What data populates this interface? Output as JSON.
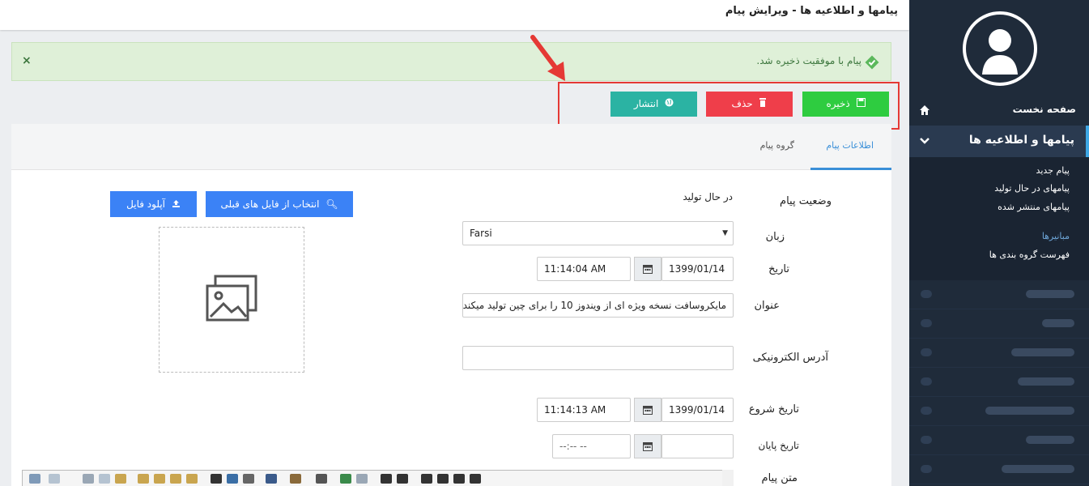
{
  "header": {
    "title": "پیامها و اطلاعیه ها - ویرایش پیام"
  },
  "alert": {
    "message": "پیام با موفقیت ذخیره شد.",
    "close": "×"
  },
  "actions": {
    "save": "ذخیره",
    "delete": "حذف",
    "publish": "انتشار"
  },
  "sidebar": {
    "home": "صفحه نخست",
    "active_menu": "پیامها و اطلاعیه ها",
    "sub_items": [
      "پیام جدید",
      "پیامهای در حال تولید",
      "پیامهای منتشر شده"
    ],
    "section": "مبانیرها",
    "section_items": [
      "فهرست گروه بندی ها"
    ]
  },
  "tabs": {
    "info": "اطلاعات پیام",
    "group": "گروه پیام"
  },
  "form": {
    "status_label": "وضعیت پیام",
    "status_value": "در حال تولید",
    "language_label": "زبان",
    "language_value": "Farsi",
    "date_label": "تاریخ",
    "date_value": "1399/01/14",
    "time_value": "11:14:04 AM",
    "title_label": "عنوان",
    "title_value": "مایکروسافت نسخه ویژه ای از ویندوز 10 را برای چین تولید میکند",
    "email_label": "آدرس الکترونیکی",
    "email_value": "",
    "start_label": "تاریخ شروع",
    "start_date": "1399/01/14",
    "start_time": "11:14:13 AM",
    "end_label": "تاریخ پایان",
    "end_date": "",
    "end_time": "--:-- --",
    "body_label": "متن پیام"
  },
  "upload": {
    "choose_previous": "انتخاب از فایل های قبلی",
    "upload_file": "آپلود فایل"
  }
}
